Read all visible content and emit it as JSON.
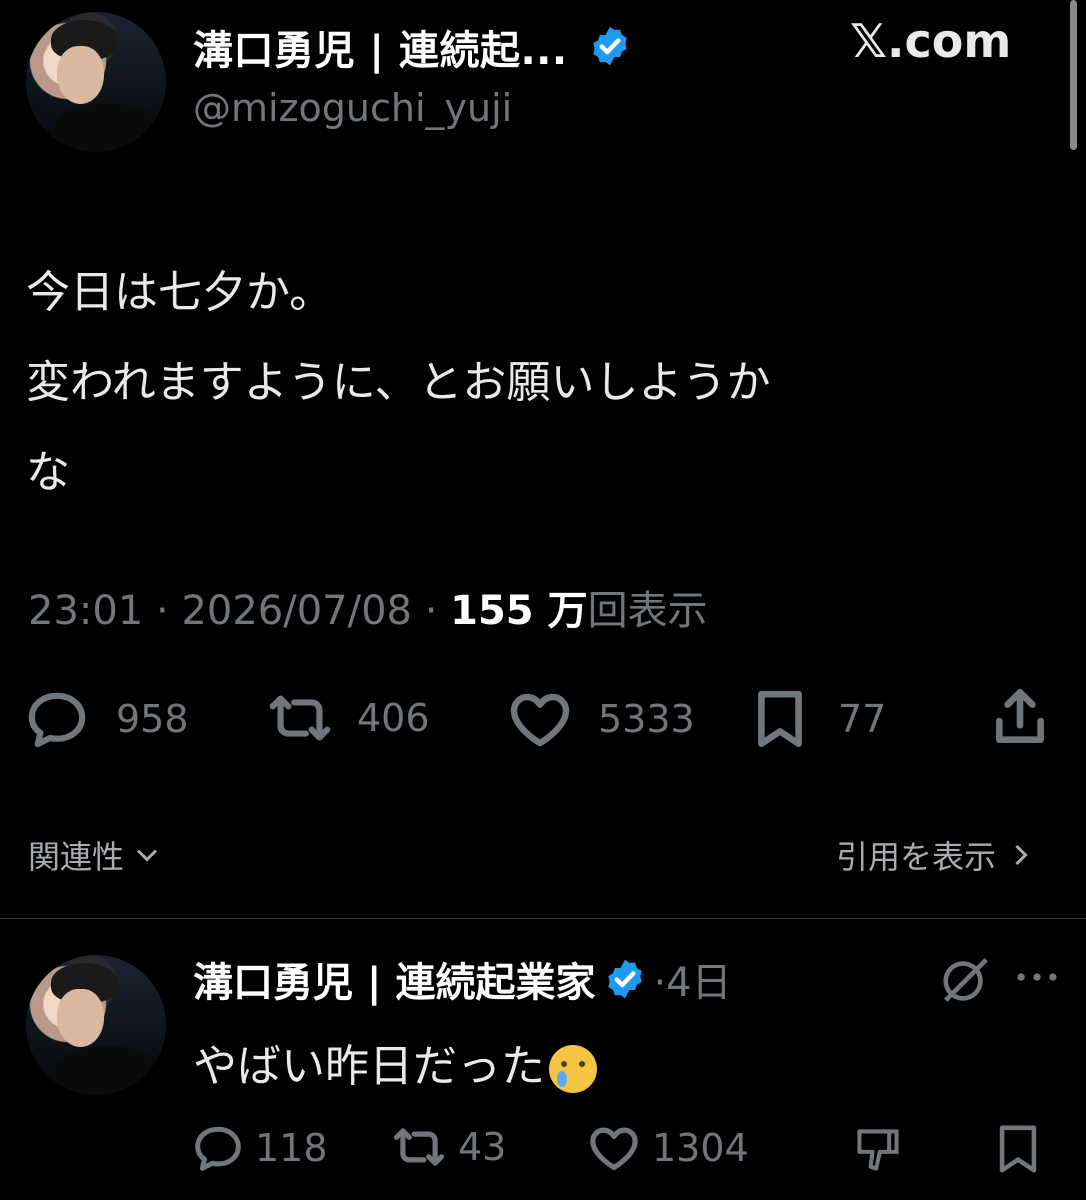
{
  "header": {
    "display_name": "溝口勇児 | 連続起...",
    "handle": "@mizoguchi_yuji",
    "site": "𝕏.com"
  },
  "tweet": {
    "text": "今日は七夕か。\n変われますように、とお願いしようか\nな",
    "time": "23:01",
    "date": "2026/07/08",
    "views_count": "155 万",
    "views_label": "回表示",
    "separator": "·",
    "actions": {
      "replies": "958",
      "retweets": "406",
      "likes": "5333",
      "bookmarks": "77"
    }
  },
  "sort": {
    "label": "関連性",
    "quotes_label": "引用を表示"
  },
  "reply": {
    "display_name": "溝口勇児 | 連続起業家",
    "time": "·4日",
    "text": "やばい昨日だった",
    "actions": {
      "replies": "118",
      "retweets": "43",
      "likes": "1304"
    }
  },
  "colors": {
    "background": "#000000",
    "text": "#e7e9ea",
    "muted": "#71767b",
    "verified": "#1d9bf0"
  }
}
